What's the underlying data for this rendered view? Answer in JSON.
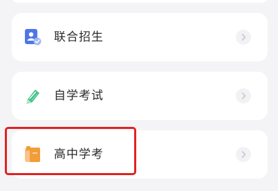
{
  "menu": {
    "items": [
      {
        "label": "联合招生",
        "icon": "user-check-icon"
      },
      {
        "label": "自学考试",
        "icon": "pencil-icon"
      },
      {
        "label": "高中学考",
        "icon": "book-icon"
      }
    ]
  },
  "colors": {
    "background": "#f4f4f7",
    "card": "#ffffff",
    "highlight": "#e0221f",
    "item_0_icon": "#4d77e6",
    "item_1_icon": "#3ec08a",
    "item_2_icon": "#f29d38"
  }
}
